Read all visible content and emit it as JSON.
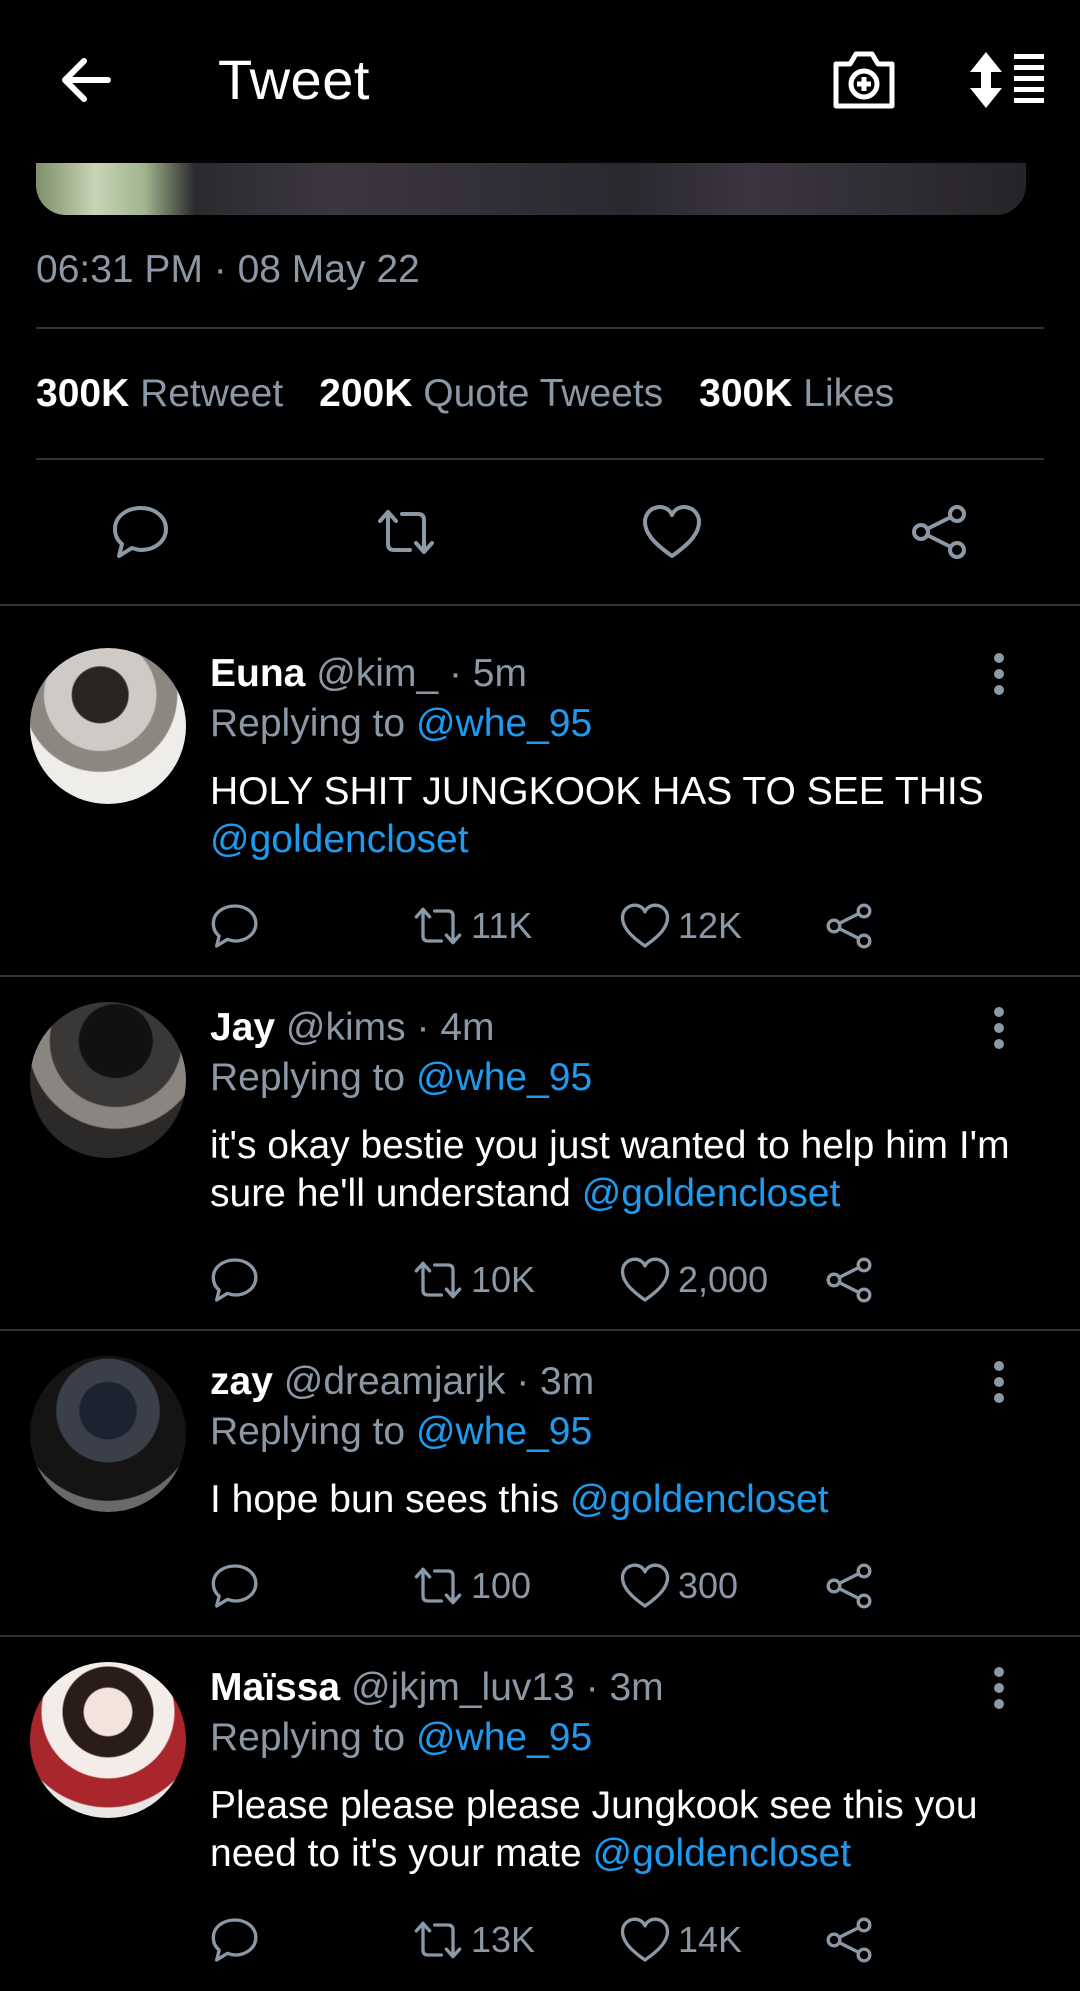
{
  "header": {
    "title": "Tweet"
  },
  "tweet": {
    "timestamp": "06:31 PM · 08 May 22",
    "stats": {
      "retweets": "300K",
      "retweets_label": "Retweet",
      "quotes": "200K",
      "quotes_label": "Quote Tweets",
      "likes": "300K",
      "likes_label": "Likes"
    }
  },
  "replies": [
    {
      "name": "Euna",
      "handle": "@kim_",
      "time": "· 5m",
      "replying_label": "Replying to",
      "replying_to": "@whe_95",
      "text": "HOLY SHIT JUNGKOOK HAS TO SEE THIS",
      "mention": "@goldencloset",
      "retweets": "11K",
      "likes": "12K"
    },
    {
      "name": "Jay",
      "handle": "@kims",
      "time": "· 4m",
      "replying_label": "Replying to",
      "replying_to": "@whe_95",
      "text": "it's okay bestie you just wanted to help him I'm sure he'll understand",
      "mention": "@goldencloset",
      "retweets": "10K",
      "likes": "2,000"
    },
    {
      "name": "zay",
      "handle": "@dreamjarjk",
      "time": "· 3m",
      "replying_label": "Replying to",
      "replying_to": "@whe_95",
      "text": "I hope bun sees this",
      "mention": "@goldencloset",
      "retweets": "100",
      "likes": "300"
    },
    {
      "name": "Maïssa",
      "handle": "@jkjm_luv13",
      "time": "· 3m",
      "replying_label": "Replying to",
      "replying_to": "@whe_95",
      "text": "Please please please Jungkook see this you need to it's your mate",
      "mention": "@goldencloset",
      "retweets": "13K",
      "likes": "14K"
    }
  ],
  "icons": {
    "back": "arrow-left-icon",
    "camera": "camera-plus-icon",
    "sort": "sort-list-icon",
    "reply": "reply-icon",
    "retweet": "retweet-icon",
    "like": "heart-icon",
    "share": "share-icon",
    "more": "more-vertical-icon"
  },
  "colors": {
    "background": "#000000",
    "text": "#ffffff",
    "secondary": "#8b98a5",
    "accent": "#1d9bf0",
    "divider": "#2f3336"
  }
}
